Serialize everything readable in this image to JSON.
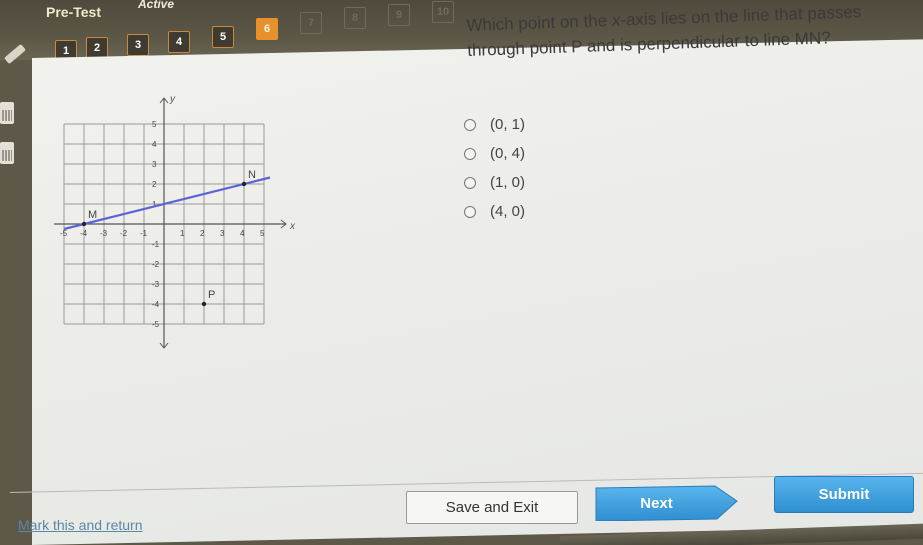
{
  "header": {
    "title": "Pre-Test",
    "status": "Active",
    "questions": [
      {
        "label": "1",
        "state": "answered"
      },
      {
        "label": "2",
        "state": "answered"
      },
      {
        "label": "3",
        "state": "answered"
      },
      {
        "label": "4",
        "state": "answered"
      },
      {
        "label": "5",
        "state": "answered"
      },
      {
        "label": "6",
        "state": "current"
      },
      {
        "label": "7",
        "state": "locked"
      },
      {
        "label": "8",
        "state": "locked"
      },
      {
        "label": "9",
        "state": "locked"
      },
      {
        "label": "10",
        "state": "locked"
      }
    ]
  },
  "tools": {
    "icons": [
      "pencil-icon",
      "calculator-icon",
      "calculator-icon"
    ]
  },
  "question": {
    "text_before": "Which point on the ",
    "variable": "x",
    "text_after": "-axis lies on the line that passes through point P and is perpendicular to line MN?"
  },
  "options": [
    {
      "label": "(0, 1)"
    },
    {
      "label": "(0, 4)"
    },
    {
      "label": "(1, 0)"
    },
    {
      "label": "(4, 0)"
    }
  ],
  "graph": {
    "x_axis_label": "x",
    "y_axis_label": "y",
    "x_ticks": [
      "-5",
      "-4",
      "-3",
      "-2",
      "-1",
      "1",
      "2",
      "3",
      "4",
      "5"
    ],
    "y_ticks": [
      "5",
      "4",
      "3",
      "2",
      "1",
      "-1",
      "-2",
      "-3",
      "-4",
      "-5"
    ],
    "x_range": [
      -5,
      5
    ],
    "y_range": [
      -5,
      5
    ],
    "points": [
      {
        "name": "M",
        "x": -4,
        "y": 0
      },
      {
        "name": "N",
        "x": 4,
        "y": 2
      },
      {
        "name": "P",
        "x": 2,
        "y": -4
      }
    ],
    "line": {
      "from": "M",
      "to": "N",
      "color": "#5a64d8"
    }
  },
  "footer": {
    "mark_link": "Mark this and return",
    "save_label": "Save and Exit",
    "next_label": "Next",
    "submit_label": "Submit"
  },
  "colors": {
    "current_question": "#e8912c",
    "button_blue": "#3a9ade",
    "link": "#5a88a6"
  }
}
